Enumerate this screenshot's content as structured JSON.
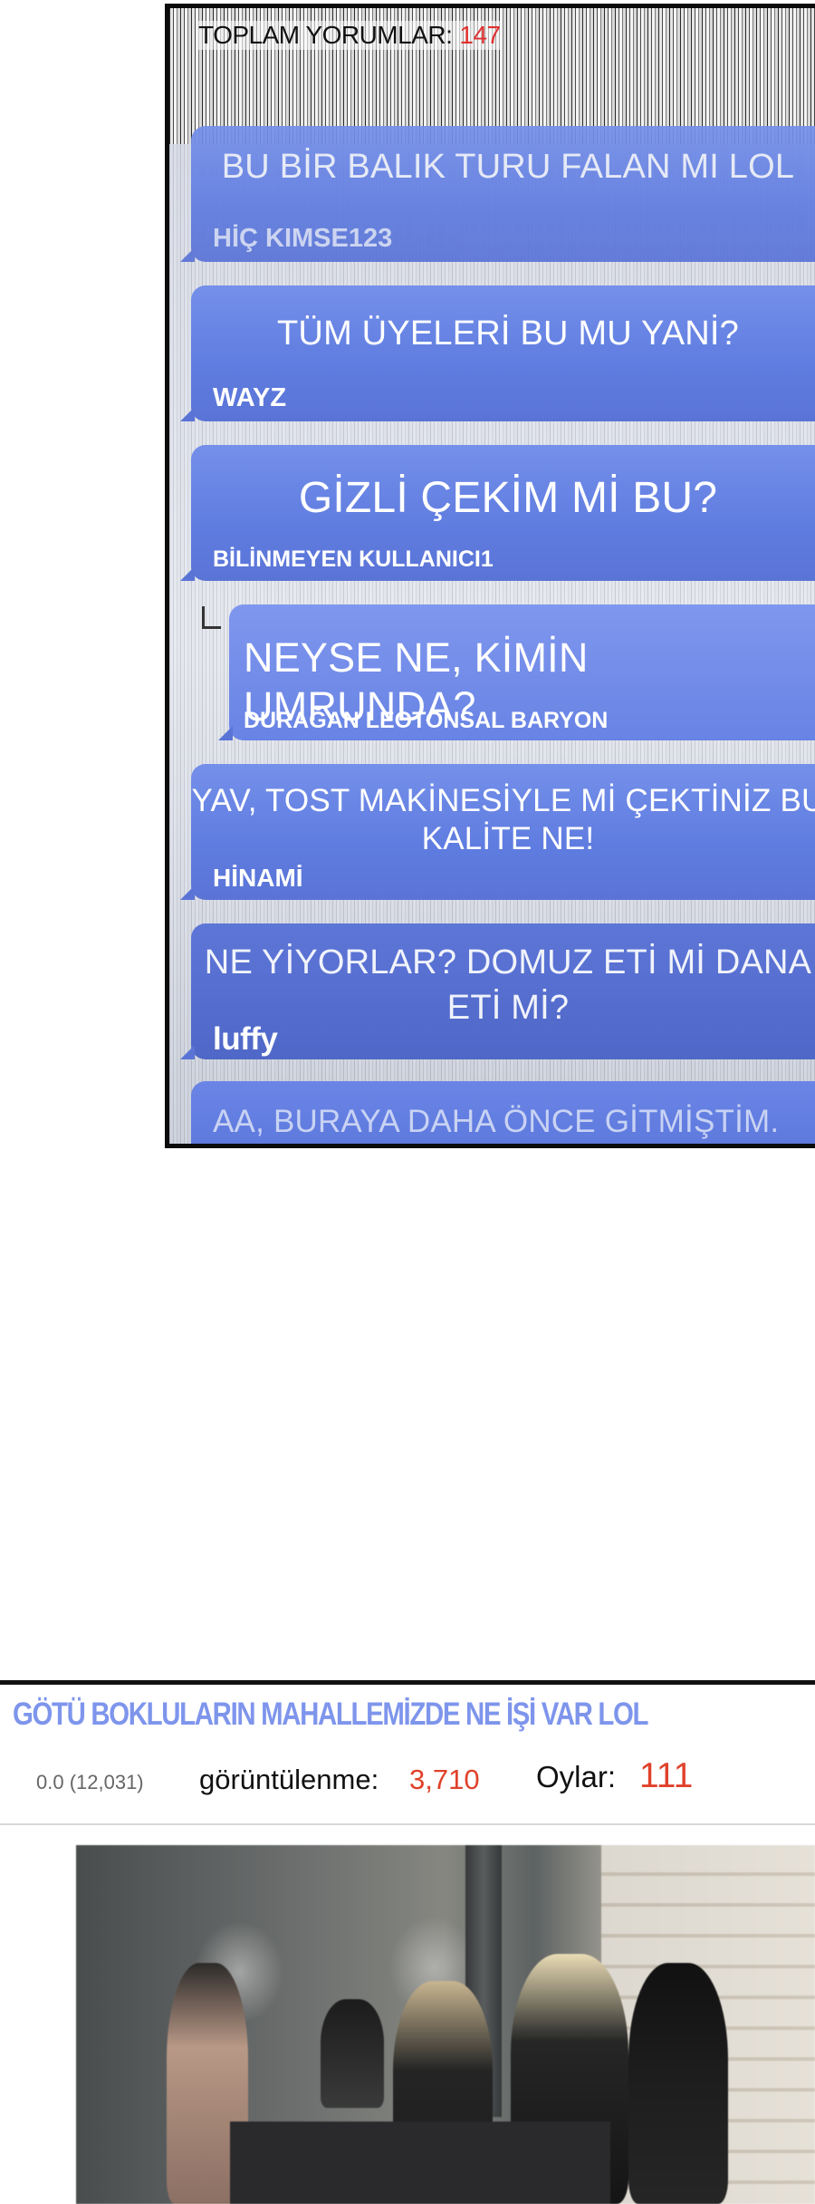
{
  "comments_section": {
    "total_label": "TOPLAM YORUMLAR:",
    "total_count": "147",
    "comments": [
      {
        "text": "BU BİR BALIK TURU FALAN MI LOL",
        "author": "HİÇ KIMSE123"
      },
      {
        "text": "TÜM ÜYELERİ BU MU YANİ?",
        "author": "WAYZ"
      },
      {
        "text": "GİZLİ ÇEKİM Mİ BU?",
        "author": "BİLİNMEYEN KULLANICI1"
      },
      {
        "text": "NEYSE NE, KİMİN UMRUNDA?",
        "author": "DURAĞAN LEOTONSAL BARYON",
        "is_reply": true
      },
      {
        "text": "YAV, TOST MAKİNESİYLE Mİ ÇEKTİNİZ BU KALİTE NE!",
        "author": "HİNAMİ"
      },
      {
        "text": "NE YİYORLAR? DOMUZ ETİ Mİ DANA ETİ Mİ?",
        "author": "luffy"
      },
      {
        "text": "AA, BURAYA DAHA ÖNCE GİTMİŞTİM.",
        "author": ""
      }
    ]
  },
  "post": {
    "title": "GÖTÜ BOKLULARIN MAHALLEMİZDE NE İŞİ VAR LOL",
    "rating": "0.0 (12,031)",
    "views_label": "görüntülenme:",
    "views_value": "3,710",
    "votes_label": "Oylar:",
    "votes_value": "111"
  },
  "colors": {
    "bubble_blue": "#5f7ce0",
    "accent_red": "#e0412b",
    "title_blue": "#7e95ec"
  }
}
